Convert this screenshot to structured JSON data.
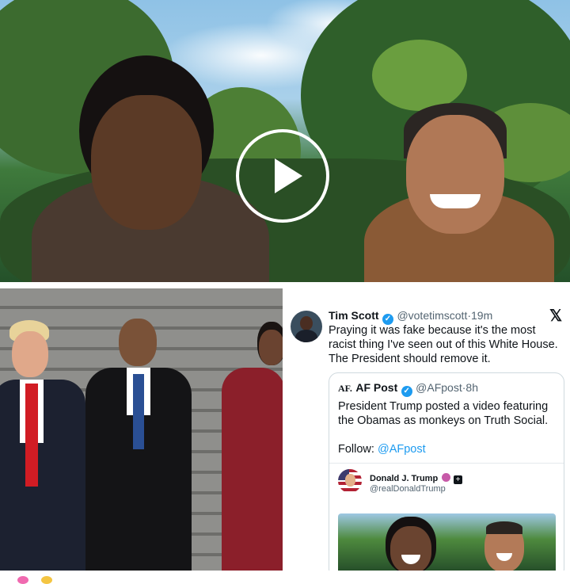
{
  "video": {
    "play_icon": "play-icon"
  },
  "tweet": {
    "author_name": "Tim Scott",
    "author_handle": "@votetimscott",
    "separator": "·",
    "time": "19m",
    "platform_logo": "𝕏",
    "body": "Praying it was fake because it's the most racist thing I've seen out of this White House. The President should remove it.",
    "quote": {
      "logo": "AF.",
      "name": "AF Post",
      "handle": "@AFpost",
      "time": "8h",
      "body": "President Trump posted a video featuring the Obamas as monkeys on Truth Social.",
      "follow_prefix": "Follow:",
      "follow_handle": "@AFpost",
      "inner": {
        "name": "Donald J. Trump",
        "handle": "@realDonaldTrump"
      }
    }
  }
}
